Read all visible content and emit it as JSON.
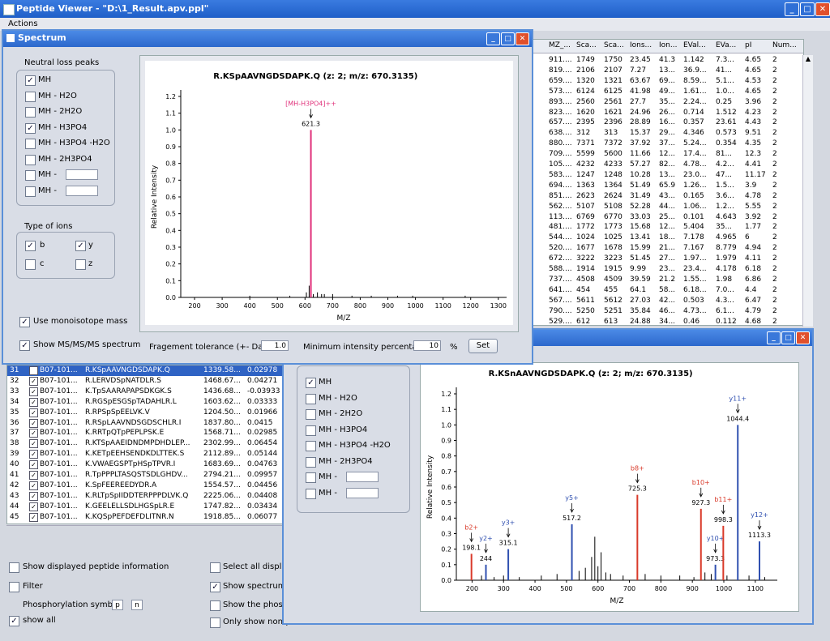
{
  "window": {
    "title": "Peptide Viewer - \"D:\\1_Result.apv.ppl\"",
    "menu": [
      "Actions"
    ]
  },
  "right_table": {
    "headers": [
      "MZ_...",
      "Sca...",
      "Sca...",
      "Ions...",
      "Ion...",
      "EVal...",
      "EVa...",
      "pI",
      "Num..."
    ],
    "rows": [
      [
        "911....",
        "1749",
        "1750",
        "23.45",
        "41.3",
        "1.142",
        "7.3...",
        "4.65",
        "2"
      ],
      [
        "819....",
        "2106",
        "2107",
        "7.27",
        "13...",
        "36.9...",
        "41...",
        "4.65",
        "2"
      ],
      [
        "659....",
        "1320",
        "1321",
        "63.67",
        "69...",
        "8.59...",
        "5.1...",
        "4.53",
        "2"
      ],
      [
        "573....",
        "6124",
        "6125",
        "41.98",
        "49...",
        "1.61...",
        "1.0...",
        "4.65",
        "2"
      ],
      [
        "893....",
        "2560",
        "2561",
        "27.7",
        "35...",
        "2.24...",
        "0.25",
        "3.96",
        "2"
      ],
      [
        "823....",
        "1620",
        "1621",
        "24.96",
        "26...",
        "0.714",
        "1.512",
        "4.23",
        "2"
      ],
      [
        "657....",
        "2395",
        "2396",
        "28.89",
        "16...",
        "0.357",
        "23.61",
        "4.43",
        "2"
      ],
      [
        "638....",
        "312",
        "313",
        "15.37",
        "29...",
        "4.346",
        "0.573",
        "9.51",
        "2"
      ],
      [
        "880....",
        "7371",
        "7372",
        "37.92",
        "37...",
        "5.24...",
        "0.354",
        "4.35",
        "2"
      ],
      [
        "709....",
        "5599",
        "5600",
        "11.66",
        "12...",
        "17.4...",
        "81...",
        "12.3",
        "2"
      ],
      [
        "105....",
        "4232",
        "4233",
        "57.27",
        "82...",
        "4.78...",
        "4.2...",
        "4.41",
        "2"
      ],
      [
        "583....",
        "1247",
        "1248",
        "10.28",
        "13...",
        "23.0...",
        "47...",
        "11.17",
        "2"
      ],
      [
        "694....",
        "1363",
        "1364",
        "51.49",
        "65.9",
        "1.26...",
        "1.5...",
        "3.9",
        "2"
      ],
      [
        "851....",
        "2623",
        "2624",
        "31.49",
        "43...",
        "0.165",
        "3.6...",
        "4.78",
        "2"
      ],
      [
        "562....",
        "5107",
        "5108",
        "52.28",
        "44...",
        "1.06...",
        "1.2...",
        "5.55",
        "2"
      ],
      [
        "113....",
        "6769",
        "6770",
        "33.03",
        "25...",
        "0.101",
        "4.643",
        "3.92",
        "2"
      ],
      [
        "481....",
        "1772",
        "1773",
        "15.68",
        "12...",
        "5.404",
        "35...",
        "1.77",
        "2"
      ],
      [
        "544....",
        "1024",
        "1025",
        "13.41",
        "18...",
        "7.178",
        "4.965",
        "6",
        "2"
      ],
      [
        "520....",
        "1677",
        "1678",
        "15.99",
        "21...",
        "7.167",
        "8.779",
        "4.94",
        "2"
      ],
      [
        "672....",
        "3222",
        "3223",
        "51.45",
        "27...",
        "1.97...",
        "1.979",
        "4.11",
        "2"
      ],
      [
        "588....",
        "1914",
        "1915",
        "9.99",
        "23...",
        "23.4...",
        "4.178",
        "6.18",
        "2"
      ],
      [
        "737....",
        "4508",
        "4509",
        "39.59",
        "21.2",
        "1.55...",
        "1.98",
        "6.86",
        "2"
      ],
      [
        "641....",
        "454",
        "455",
        "64.1",
        "58...",
        "6.18...",
        "7.0...",
        "4.4",
        "2"
      ],
      [
        "567....",
        "5611",
        "5612",
        "27.03",
        "42...",
        "0.503",
        "4.3...",
        "6.47",
        "2"
      ],
      [
        "790....",
        "5250",
        "5251",
        "35.84",
        "46...",
        "4.73...",
        "6.1...",
        "4.79",
        "2"
      ],
      [
        "529....",
        "612",
        "613",
        "24.88",
        "34...",
        "0.46",
        "0.112",
        "4.68",
        "2"
      ]
    ]
  },
  "spectrum_dialog": {
    "title": "Spectrum",
    "neutral_loss": {
      "title": "Neutral loss peaks",
      "items": [
        {
          "label": "MH",
          "checked": "✓"
        },
        {
          "label": "MH - H2O",
          "checked": ""
        },
        {
          "label": "MH - 2H2O",
          "checked": ""
        },
        {
          "label": "MH - H3PO4",
          "checked": "✓"
        },
        {
          "label": "MH - H3PO4 -H2O",
          "checked": ""
        },
        {
          "label": "MH - 2H3PO4",
          "checked": ""
        },
        {
          "label": "MH  -",
          "checked": ""
        },
        {
          "label": "MH  -",
          "checked": ""
        }
      ]
    },
    "ion_types": {
      "title": "Type of ions",
      "b": {
        "label": "b",
        "checked": "✓"
      },
      "y": {
        "label": "y",
        "checked": "✓"
      },
      "c": {
        "label": "c",
        "checked": ""
      },
      "z": {
        "label": "z",
        "checked": ""
      }
    },
    "mono": {
      "label": "Use monoisotope mass",
      "checked": "✓"
    },
    "msms": {
      "label": "Show MS/MS/MS spectrum",
      "checked": "✓"
    },
    "fragment_tolerance": {
      "label": "Fragement tolerance (+- Da)",
      "value": "1.0"
    },
    "min_intensity": {
      "label": "Minimum intensity percentage",
      "value": "10",
      "unit": "%"
    },
    "set_button": "Set"
  },
  "chart_data": [
    {
      "type": "bar",
      "title": "R.KSpAAVNGDSDAPK.Q (z: 2; m/z: 670.3135)",
      "xlabel": "M/Z",
      "ylabel": "Relative Intensity",
      "xlim": [
        150,
        1330
      ],
      "ylim": [
        0,
        1.2
      ],
      "xticks": [
        "200",
        "300",
        "400",
        "500",
        "600",
        "700",
        "800",
        "900",
        "1000",
        "1100",
        "1200",
        "1300"
      ],
      "yticks": [
        "0.0",
        "0.1",
        "0.2",
        "0.3",
        "0.4",
        "0.5",
        "0.6",
        "0.7",
        "0.8",
        "0.9",
        "1.0",
        "1.1",
        "1.2"
      ],
      "labeled_peaks": [
        {
          "x": 621.3,
          "y": 1.0,
          "label": "[MH-H3PO4]++",
          "value_label": "621.3",
          "color": "#e0307a"
        }
      ],
      "background_peaks": [
        [
          605,
          0.03
        ],
        [
          615,
          0.07
        ],
        [
          622,
          0.05
        ],
        [
          630,
          0.02
        ],
        [
          645,
          0.03
        ],
        [
          660,
          0.02
        ],
        [
          670,
          0.02
        ],
        [
          700,
          0.02
        ],
        [
          770,
          0.01
        ],
        [
          840,
          0.01
        ],
        [
          935,
          0.01
        ],
        [
          990,
          0.01
        ],
        [
          1180,
          0.01
        ],
        [
          400,
          0.01
        ],
        [
          545,
          0.01
        ]
      ]
    },
    {
      "type": "bar",
      "title": "R.KSnAAVNGDSDAPK.Q (z: 2; m/z: 670.3135)",
      "xlabel": "M/Z",
      "ylabel": "Relative Intensity",
      "xlim": [
        150,
        1170
      ],
      "ylim": [
        0,
        1.2
      ],
      "xticks": [
        "200",
        "300",
        "400",
        "500",
        "600",
        "700",
        "800",
        "900",
        "1000",
        "1100"
      ],
      "yticks": [
        "0.0",
        "0.1",
        "0.2",
        "0.3",
        "0.4",
        "0.5",
        "0.6",
        "0.7",
        "0.8",
        "0.9",
        "1.0",
        "1.1",
        "1.2"
      ],
      "labeled_peaks": [
        {
          "x": 198.1,
          "y": 0.17,
          "label": "b2+",
          "value_label": "198.1",
          "color": "#d93a2a"
        },
        {
          "x": 244,
          "y": 0.1,
          "label": "y2+",
          "value_label": "244",
          "color": "#3050b0"
        },
        {
          "x": 315.1,
          "y": 0.2,
          "label": "y3+",
          "value_label": "315.1",
          "color": "#3050b0"
        },
        {
          "x": 517.2,
          "y": 0.36,
          "label": "y5+",
          "value_label": "517.2",
          "color": "#3050b0"
        },
        {
          "x": 725.3,
          "y": 0.55,
          "label": "b8+",
          "value_label": "725.3",
          "color": "#d93a2a"
        },
        {
          "x": 927.3,
          "y": 0.46,
          "label": "b10+",
          "value_label": "927.3",
          "color": "#d93a2a"
        },
        {
          "x": 973.3,
          "y": 0.1,
          "label": "y10+",
          "value_label": "973.3",
          "color": "#3050b0"
        },
        {
          "x": 998.3,
          "y": 0.35,
          "label": "b11+",
          "value_label": "998.3",
          "color": "#d93a2a"
        },
        {
          "x": 1044.4,
          "y": 1.0,
          "label": "y11+",
          "value_label": "1044.4",
          "color": "#3050b0"
        },
        {
          "x": 1113.3,
          "y": 0.25,
          "label": "y12+",
          "value_label": "1113.3",
          "color": "#3050b0"
        }
      ],
      "background_peaks": [
        [
          230,
          0.03
        ],
        [
          270,
          0.02
        ],
        [
          300,
          0.03
        ],
        [
          350,
          0.02
        ],
        [
          420,
          0.03
        ],
        [
          470,
          0.04
        ],
        [
          540,
          0.06
        ],
        [
          560,
          0.08
        ],
        [
          580,
          0.15
        ],
        [
          590,
          0.28
        ],
        [
          600,
          0.09
        ],
        [
          610,
          0.18
        ],
        [
          625,
          0.05
        ],
        [
          640,
          0.04
        ],
        [
          680,
          0.03
        ],
        [
          750,
          0.04
        ],
        [
          800,
          0.03
        ],
        [
          860,
          0.03
        ],
        [
          905,
          0.02
        ],
        [
          940,
          0.05
        ],
        [
          960,
          0.04
        ],
        [
          1010,
          0.03
        ],
        [
          1080,
          0.03
        ],
        [
          1130,
          0.02
        ]
      ]
    }
  ],
  "second_dialog": {
    "items": [
      {
        "label": "MH",
        "checked": "✓"
      },
      {
        "label": "MH - H2O",
        "checked": ""
      },
      {
        "label": "MH - 2H2O",
        "checked": ""
      },
      {
        "label": "MH - H3PO4",
        "checked": ""
      },
      {
        "label": "MH - H3PO4 -H2O",
        "checked": ""
      },
      {
        "label": "MH - 2H3PO4",
        "checked": ""
      },
      {
        "label": "MH  -",
        "checked": ""
      },
      {
        "label": "MH  -",
        "checked": ""
      }
    ]
  },
  "peptide_list": [
    {
      "n": "31",
      "id": "B07-101...",
      "seq": "R.KSpAAVNGDSDAPK.Q",
      "mass": "1339.58...",
      "delta": "0.02978",
      "selected": true
    },
    {
      "n": "32",
      "id": "B07-101...",
      "seq": "R.LERVDSpNATDLR.S",
      "mass": "1468.67...",
      "delta": "0.04271",
      "selected": false
    },
    {
      "n": "33",
      "id": "B07-101...",
      "seq": "K.TpSAARAPAPSDKGK.S",
      "mass": "1436.68...",
      "delta": "-0.03933",
      "selected": false
    },
    {
      "n": "34",
      "id": "B07-101...",
      "seq": "R.RGSpESGSpTADAHLR.L",
      "mass": "1603.62...",
      "delta": "0.03333",
      "selected": false
    },
    {
      "n": "35",
      "id": "B07-101...",
      "seq": "R.RPSpSpEELVK.V",
      "mass": "1204.50...",
      "delta": "0.01966",
      "selected": false
    },
    {
      "n": "36",
      "id": "B07-101...",
      "seq": "R.RSpLAAVNDSGDSCHLR.I",
      "mass": "1837.80...",
      "delta": "0.0415",
      "selected": false
    },
    {
      "n": "37",
      "id": "B07-101...",
      "seq": "K.RRTpQTpPEPLPSK.E",
      "mass": "1568.71...",
      "delta": "0.02985",
      "selected": false
    },
    {
      "n": "38",
      "id": "B07-101...",
      "seq": "R.KTSpAAEIDNDMPDHDLEP...",
      "mass": "2302.99...",
      "delta": "0.06454",
      "selected": false
    },
    {
      "n": "39",
      "id": "B07-101...",
      "seq": "K.KETpEEHSENDKDLTTEK.S",
      "mass": "2112.89...",
      "delta": "0.05144",
      "selected": false
    },
    {
      "n": "40",
      "id": "B07-101...",
      "seq": "K.VWAEGSPTpHSpTPVR.I",
      "mass": "1683.69...",
      "delta": "0.04763",
      "selected": false
    },
    {
      "n": "41",
      "id": "B07-101...",
      "seq": "R.TpPPPLTASQSTSDLGHDV...",
      "mass": "2794.21...",
      "delta": "0.09957",
      "selected": false
    },
    {
      "n": "42",
      "id": "B07-101...",
      "seq": "K.SpFEEREEDYDR.A",
      "mass": "1554.57...",
      "delta": "0.04456",
      "selected": false
    },
    {
      "n": "43",
      "id": "B07-101...",
      "seq": "K.RLTpSpIIDDTERPPPDLVK.Q",
      "mass": "2225.06...",
      "delta": "0.04408",
      "selected": false
    },
    {
      "n": "44",
      "id": "B07-101...",
      "seq": "K.GEELELLSDLHGSpLR.E",
      "mass": "1747.82...",
      "delta": "0.03434",
      "selected": false
    },
    {
      "n": "45",
      "id": "B07-101...",
      "seq": "K.KQSpPEFDEFDLITNR.N",
      "mass": "1918.85...",
      "delta": "0.06077",
      "selected": false
    }
  ],
  "bottom_options": {
    "show_info": {
      "label": "Show displayed peptide information",
      "checked": ""
    },
    "filter": {
      "label": "Filter",
      "checked": ""
    },
    "phospho_symbol": {
      "label": "Phosphorylation symbol",
      "p": "p",
      "n": "n"
    },
    "show_all": {
      "label": "show all",
      "checked": "✓"
    },
    "select_all": {
      "label": "Select all display",
      "checked": ""
    },
    "show_spectrum": {
      "label": "Show spectrum r",
      "checked": "✓"
    },
    "show_phospho": {
      "label": "Show the phosph",
      "checked": ""
    },
    "only_show": {
      "label": "Only show non-p",
      "checked": ""
    }
  }
}
